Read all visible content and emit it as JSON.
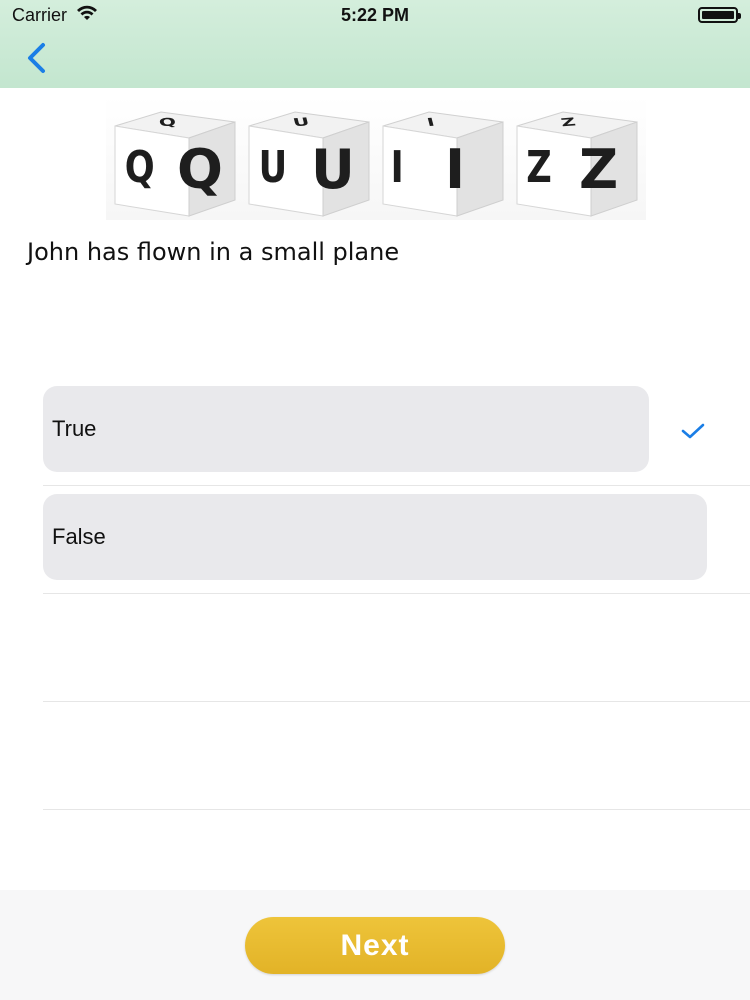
{
  "status_bar": {
    "carrier": "Carrier",
    "time": "5:22 PM"
  },
  "logo": {
    "alt": "QUIZZ",
    "cubes": [
      {
        "left": "Q",
        "right": "Q",
        "top": "Q"
      },
      {
        "left": "U",
        "right": "U",
        "top": "U"
      },
      {
        "left": "I",
        "right": "I",
        "top": "I"
      },
      {
        "left": "Z",
        "right": "Z",
        "top": "Z"
      }
    ]
  },
  "question": "John has flown in a small plane",
  "options": [
    {
      "label": "True",
      "selected": true
    },
    {
      "label": "False",
      "selected": false
    }
  ],
  "next_label": "Next",
  "colors": {
    "accent": "#1a7ee6",
    "next_button": "#e8bb30",
    "nav_bar": "#c8e8d3"
  }
}
